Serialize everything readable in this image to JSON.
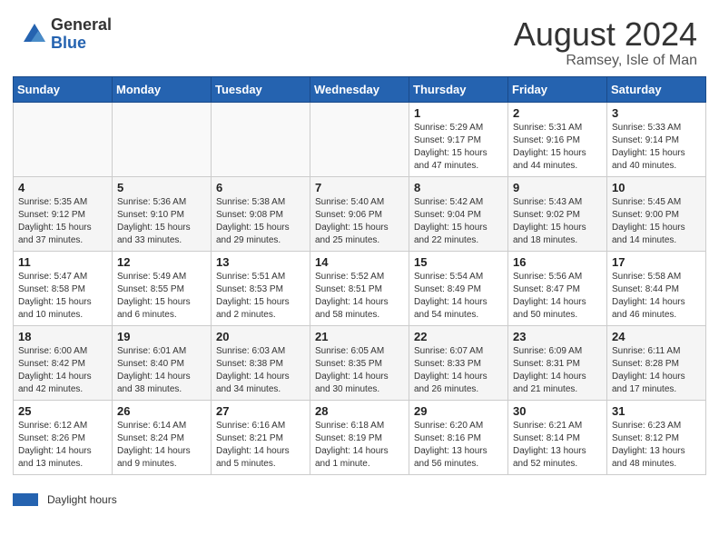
{
  "header": {
    "logo_general": "General",
    "logo_blue": "Blue",
    "month_year": "August 2024",
    "location": "Ramsey, Isle of Man"
  },
  "days_of_week": [
    "Sunday",
    "Monday",
    "Tuesday",
    "Wednesday",
    "Thursday",
    "Friday",
    "Saturday"
  ],
  "weeks": [
    [
      {
        "day": "",
        "info": ""
      },
      {
        "day": "",
        "info": ""
      },
      {
        "day": "",
        "info": ""
      },
      {
        "day": "",
        "info": ""
      },
      {
        "day": "1",
        "info": "Sunrise: 5:29 AM\nSunset: 9:17 PM\nDaylight: 15 hours\nand 47 minutes."
      },
      {
        "day": "2",
        "info": "Sunrise: 5:31 AM\nSunset: 9:16 PM\nDaylight: 15 hours\nand 44 minutes."
      },
      {
        "day": "3",
        "info": "Sunrise: 5:33 AM\nSunset: 9:14 PM\nDaylight: 15 hours\nand 40 minutes."
      }
    ],
    [
      {
        "day": "4",
        "info": "Sunrise: 5:35 AM\nSunset: 9:12 PM\nDaylight: 15 hours\nand 37 minutes."
      },
      {
        "day": "5",
        "info": "Sunrise: 5:36 AM\nSunset: 9:10 PM\nDaylight: 15 hours\nand 33 minutes."
      },
      {
        "day": "6",
        "info": "Sunrise: 5:38 AM\nSunset: 9:08 PM\nDaylight: 15 hours\nand 29 minutes."
      },
      {
        "day": "7",
        "info": "Sunrise: 5:40 AM\nSunset: 9:06 PM\nDaylight: 15 hours\nand 25 minutes."
      },
      {
        "day": "8",
        "info": "Sunrise: 5:42 AM\nSunset: 9:04 PM\nDaylight: 15 hours\nand 22 minutes."
      },
      {
        "day": "9",
        "info": "Sunrise: 5:43 AM\nSunset: 9:02 PM\nDaylight: 15 hours\nand 18 minutes."
      },
      {
        "day": "10",
        "info": "Sunrise: 5:45 AM\nSunset: 9:00 PM\nDaylight: 15 hours\nand 14 minutes."
      }
    ],
    [
      {
        "day": "11",
        "info": "Sunrise: 5:47 AM\nSunset: 8:58 PM\nDaylight: 15 hours\nand 10 minutes."
      },
      {
        "day": "12",
        "info": "Sunrise: 5:49 AM\nSunset: 8:55 PM\nDaylight: 15 hours\nand 6 minutes."
      },
      {
        "day": "13",
        "info": "Sunrise: 5:51 AM\nSunset: 8:53 PM\nDaylight: 15 hours\nand 2 minutes."
      },
      {
        "day": "14",
        "info": "Sunrise: 5:52 AM\nSunset: 8:51 PM\nDaylight: 14 hours\nand 58 minutes."
      },
      {
        "day": "15",
        "info": "Sunrise: 5:54 AM\nSunset: 8:49 PM\nDaylight: 14 hours\nand 54 minutes."
      },
      {
        "day": "16",
        "info": "Sunrise: 5:56 AM\nSunset: 8:47 PM\nDaylight: 14 hours\nand 50 minutes."
      },
      {
        "day": "17",
        "info": "Sunrise: 5:58 AM\nSunset: 8:44 PM\nDaylight: 14 hours\nand 46 minutes."
      }
    ],
    [
      {
        "day": "18",
        "info": "Sunrise: 6:00 AM\nSunset: 8:42 PM\nDaylight: 14 hours\nand 42 minutes."
      },
      {
        "day": "19",
        "info": "Sunrise: 6:01 AM\nSunset: 8:40 PM\nDaylight: 14 hours\nand 38 minutes."
      },
      {
        "day": "20",
        "info": "Sunrise: 6:03 AM\nSunset: 8:38 PM\nDaylight: 14 hours\nand 34 minutes."
      },
      {
        "day": "21",
        "info": "Sunrise: 6:05 AM\nSunset: 8:35 PM\nDaylight: 14 hours\nand 30 minutes."
      },
      {
        "day": "22",
        "info": "Sunrise: 6:07 AM\nSunset: 8:33 PM\nDaylight: 14 hours\nand 26 minutes."
      },
      {
        "day": "23",
        "info": "Sunrise: 6:09 AM\nSunset: 8:31 PM\nDaylight: 14 hours\nand 21 minutes."
      },
      {
        "day": "24",
        "info": "Sunrise: 6:11 AM\nSunset: 8:28 PM\nDaylight: 14 hours\nand 17 minutes."
      }
    ],
    [
      {
        "day": "25",
        "info": "Sunrise: 6:12 AM\nSunset: 8:26 PM\nDaylight: 14 hours\nand 13 minutes."
      },
      {
        "day": "26",
        "info": "Sunrise: 6:14 AM\nSunset: 8:24 PM\nDaylight: 14 hours\nand 9 minutes."
      },
      {
        "day": "27",
        "info": "Sunrise: 6:16 AM\nSunset: 8:21 PM\nDaylight: 14 hours\nand 5 minutes."
      },
      {
        "day": "28",
        "info": "Sunrise: 6:18 AM\nSunset: 8:19 PM\nDaylight: 14 hours\nand 1 minute."
      },
      {
        "day": "29",
        "info": "Sunrise: 6:20 AM\nSunset: 8:16 PM\nDaylight: 13 hours\nand 56 minutes."
      },
      {
        "day": "30",
        "info": "Sunrise: 6:21 AM\nSunset: 8:14 PM\nDaylight: 13 hours\nand 52 minutes."
      },
      {
        "day": "31",
        "info": "Sunrise: 6:23 AM\nSunset: 8:12 PM\nDaylight: 13 hours\nand 48 minutes."
      }
    ]
  ],
  "footer": {
    "daylight_label": "Daylight hours"
  }
}
